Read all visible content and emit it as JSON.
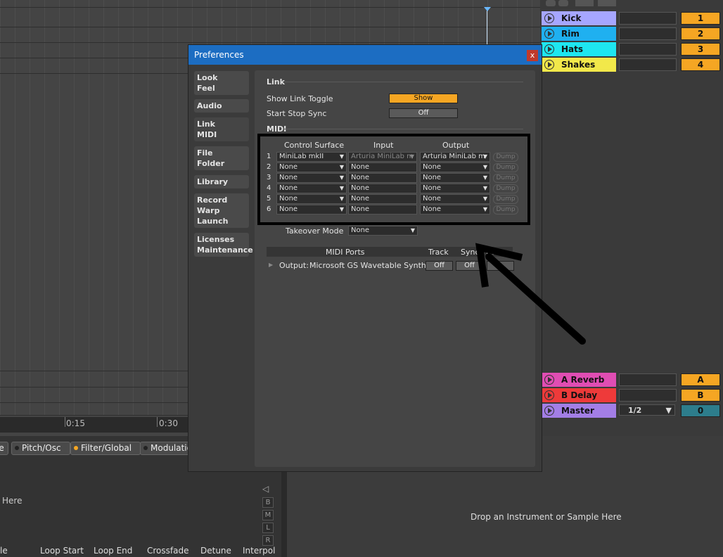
{
  "timeline": {
    "mark1": "0:15",
    "mark2": "0:30"
  },
  "tracks": [
    {
      "name": "Kick",
      "color": "#a6a6ff",
      "num": "1",
      "numcolor": "#f5a623"
    },
    {
      "name": "Rim",
      "color": "#1fb0f0",
      "num": "2",
      "numcolor": "#f5a623"
    },
    {
      "name": "Hats",
      "color": "#1ee6f0",
      "num": "3",
      "numcolor": "#f5a623"
    },
    {
      "name": "Shakes",
      "color": "#f2e84a",
      "num": "4",
      "numcolor": "#f5a623"
    }
  ],
  "returns": [
    {
      "name": "A Reverb",
      "color": "#e04db3",
      "num": "A",
      "numcolor": "#f5a623"
    },
    {
      "name": "B Delay",
      "color": "#ee3a3a",
      "num": "B",
      "numcolor": "#f5a623"
    }
  ],
  "master": {
    "name": "Master",
    "color": "#a37ee6",
    "route": "1/2",
    "num": "0",
    "numcolor": "#2d7d8c"
  },
  "device_tabs": [
    "le",
    "Pitch/Osc",
    "Filter/Global",
    "Modulatio"
  ],
  "device_drop_left": "Here",
  "device_drop_right": "Drop an Instrument or Sample Here",
  "bm_buttons": [
    "B",
    "M",
    "L",
    "R"
  ],
  "bottom_labels": [
    "le",
    "Loop Start",
    "Loop End",
    "Crossfade",
    "Detune",
    "Interpol"
  ],
  "prefs": {
    "title": "Preferences",
    "close": "x",
    "tabs": [
      [
        "Look",
        "Feel"
      ],
      [
        "Audio"
      ],
      [
        "Link",
        "MIDI"
      ],
      [
        "File",
        "Folder"
      ],
      [
        "Library"
      ],
      [
        "Record",
        "Warp",
        "Launch"
      ],
      [
        "Licenses",
        "Maintenance"
      ]
    ],
    "link_section": "Link",
    "show_link_toggle_label": "Show Link Toggle",
    "show_link_toggle_value": "Show",
    "start_stop_sync_label": "Start Stop Sync",
    "start_stop_sync_value": "Off",
    "midi_section": "MIDI",
    "col_control": "Control Surface",
    "col_input": "Input",
    "col_output": "Output",
    "midi_rows": [
      {
        "n": "1",
        "cs": "MiniLab mkII",
        "in": "Arturia MiniLab m",
        "out": "Arturia MiniLab m",
        "dump": "Dump"
      },
      {
        "n": "2",
        "cs": "None",
        "in": "None",
        "out": "None",
        "dump": "Dump"
      },
      {
        "n": "3",
        "cs": "None",
        "in": "None",
        "out": "None",
        "dump": "Dump"
      },
      {
        "n": "4",
        "cs": "None",
        "in": "None",
        "out": "None",
        "dump": "Dump"
      },
      {
        "n": "5",
        "cs": "None",
        "in": "None",
        "out": "None",
        "dump": "Dump"
      },
      {
        "n": "6",
        "cs": "None",
        "in": "None",
        "out": "None",
        "dump": "Dump"
      }
    ],
    "takeover_label": "Takeover Mode",
    "takeover_value": "None",
    "ports_head": "MIDI Ports",
    "ports_track": "Track",
    "ports_sync": "Sync",
    "ports_remote": "Rem",
    "port_output_label": "Output:",
    "port_output_name": "Microsoft GS Wavetable Synth",
    "port_track_value": "Off",
    "port_sync_value": "Off"
  }
}
